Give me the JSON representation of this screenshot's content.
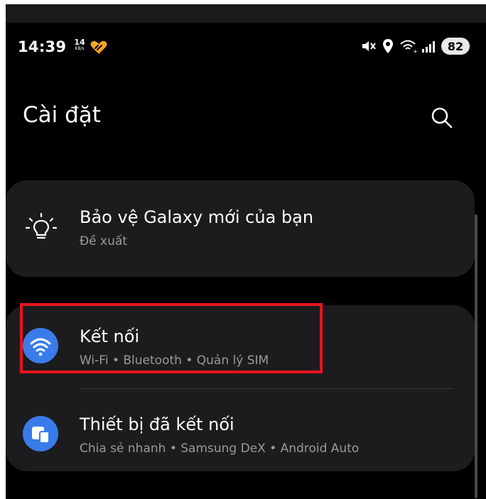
{
  "status_bar": {
    "time": "14:39",
    "net_speed_value": "14",
    "net_speed_unit": "KB/s",
    "battery": "82",
    "icons": [
      "heart-icon",
      "mute-icon",
      "location-icon",
      "wifi-call-icon",
      "signal-icon",
      "battery-icon"
    ]
  },
  "header": {
    "title": "Cài đặt",
    "search_icon": "search-icon"
  },
  "cards": [
    {
      "items": [
        {
          "icon": "lightbulb-icon",
          "title": "Bảo vệ Galaxy mới của bạn",
          "subtitle": "Đề xuất"
        }
      ]
    },
    {
      "items": [
        {
          "icon": "wifi-icon",
          "title": "Kết nối",
          "subtitle": "Wi-Fi  •  Bluetooth  •  Quản lý SIM"
        },
        {
          "icon": "connected-devices-icon",
          "title": "Thiết bị đã kết nối",
          "subtitle": "Chia sẻ nhanh  •  Samsung DeX  •  Android Auto"
        }
      ]
    }
  ],
  "colors": {
    "background": "#000000",
    "card": "#1c1c1e",
    "accent_blue": "#3a7bea",
    "highlight_red": "#e8141b",
    "subtitle": "#9a9a9a"
  }
}
